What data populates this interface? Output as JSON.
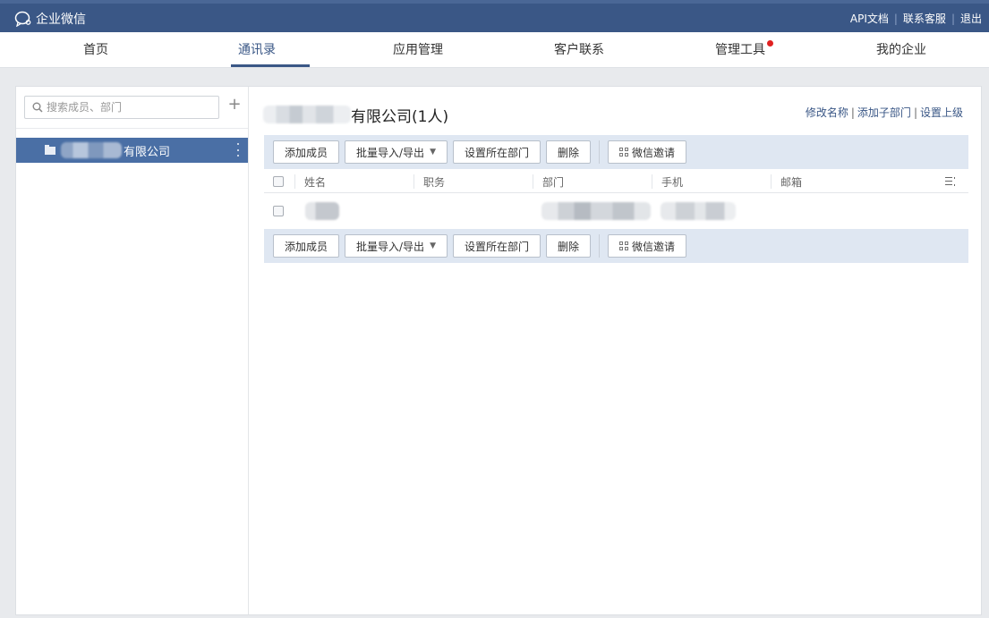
{
  "topbar": {
    "logo_text": "企业微信",
    "links": [
      "API文档",
      "联系客服",
      "退出"
    ],
    "separator": "|"
  },
  "nav": {
    "items": [
      "首页",
      "通讯录",
      "应用管理",
      "客户联系",
      "管理工具",
      "我的企业"
    ],
    "active": "通讯录",
    "notification_dot_on": "管理工具"
  },
  "sidebar": {
    "search_placeholder": "搜索成员、部门",
    "add_symbol": "+",
    "tree": [
      {
        "label_visible": "有限公司",
        "selected": true
      }
    ]
  },
  "main": {
    "title": "有限公司(1人)",
    "title_links": [
      "修改名称",
      "添加子部门",
      "设置上级"
    ],
    "toolbar_buttons": {
      "add_member": "添加成员",
      "batch_import_export": "批量导入/导出",
      "set_department": "设置所在部门",
      "delete": "删除",
      "wechat_invite": "微信邀请"
    },
    "dropdown_caret": "▼",
    "table": {
      "columns": [
        "姓名",
        "职务",
        "部门",
        "手机",
        "邮箱"
      ],
      "rows": 1
    }
  },
  "colors": {
    "topbar_bg": "#3a5786",
    "accent": "#3a5786",
    "selected_tree_bg": "#4a6fa5",
    "toolbar_bg": "#dfe7f2",
    "notification_dot": "#e02020"
  }
}
